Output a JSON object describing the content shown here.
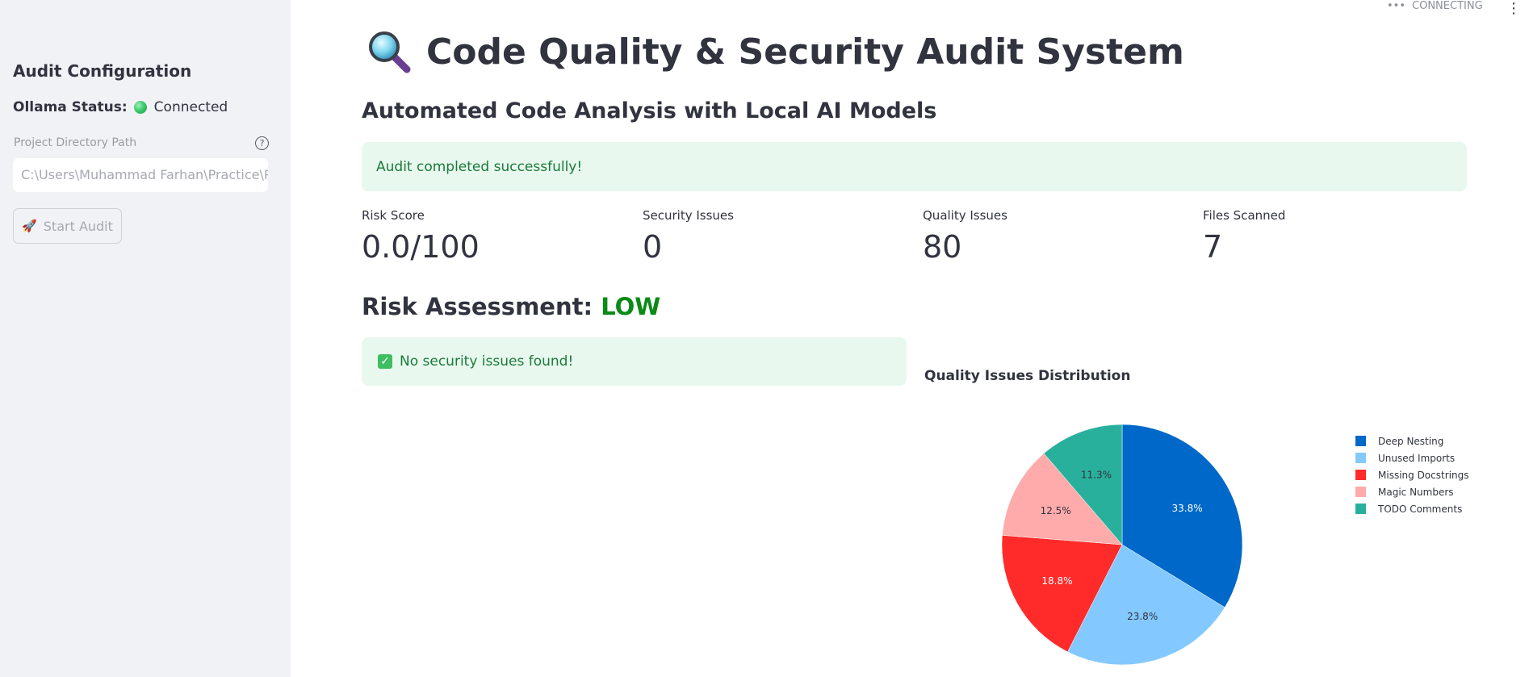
{
  "sidebar": {
    "title": "Audit Configuration",
    "status_label": "Ollama Status:",
    "status_value": "Connected",
    "path_label": "Project Directory Path",
    "path_value": "C:\\Users\\Muhammad Farhan\\Practice\\Po",
    "start_button": "Start Audit"
  },
  "app_status": {
    "text": "CONNECTING"
  },
  "header": {
    "title": "Code Quality & Security Audit System",
    "subtitle": "Automated Code Analysis with Local AI Models"
  },
  "alert_success": "Audit completed successfully!",
  "metrics": [
    {
      "label": "Risk Score",
      "value": "0.0/100"
    },
    {
      "label": "Security Issues",
      "value": "0"
    },
    {
      "label": "Quality Issues",
      "value": "80"
    },
    {
      "label": "Files Scanned",
      "value": "7"
    }
  ],
  "risk": {
    "prefix": "Risk Assessment:",
    "level": "LOW",
    "level_color": "#0a8a16"
  },
  "security_alert": "No security issues found!",
  "chart_data": {
    "type": "pie",
    "title": "Quality Issues Distribution",
    "legend_position": "right",
    "categories": [
      "Deep Nesting",
      "Unused Imports",
      "Missing Docstrings",
      "Magic Numbers",
      "TODO Comments"
    ],
    "values": [
      33.8,
      23.8,
      18.8,
      12.5,
      11.3
    ],
    "labels": [
      "33.8%",
      "23.8%",
      "18.8%",
      "12.5%",
      "11.3%"
    ],
    "colors": [
      "#0068c9",
      "#83c9ff",
      "#ff2b2b",
      "#ffabab",
      "#29b09d"
    ],
    "label_colors": [
      "#ffffff",
      "#31333f",
      "#ffffff",
      "#31333f",
      "#31333f"
    ]
  }
}
